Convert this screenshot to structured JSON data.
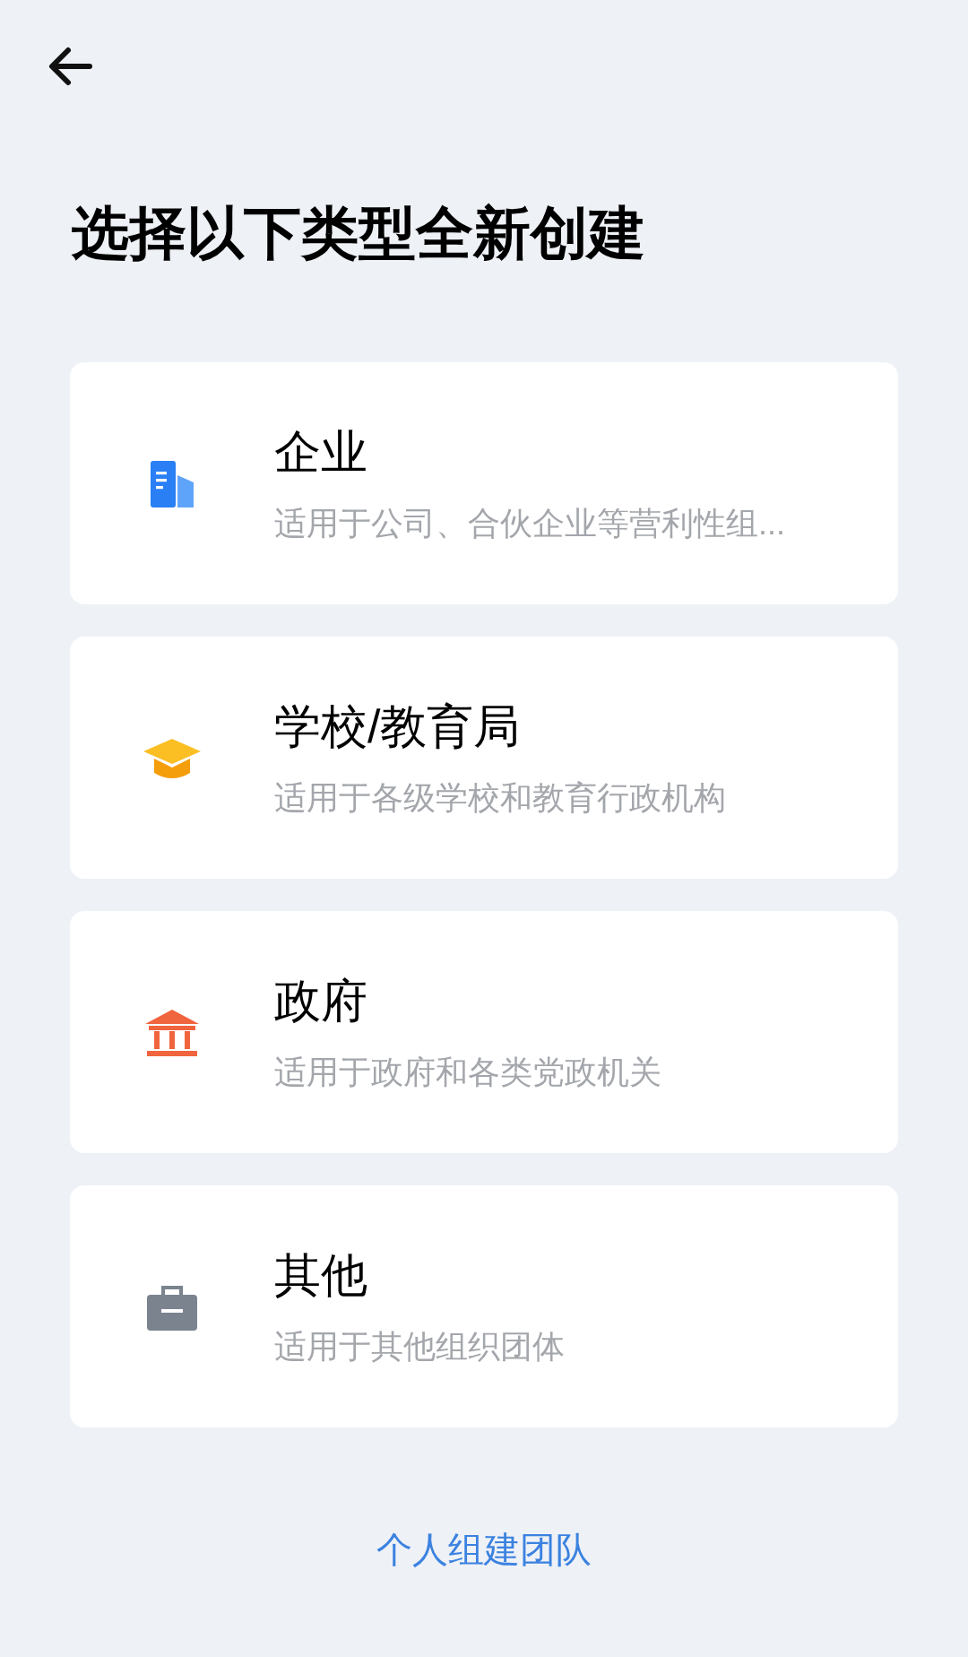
{
  "title": "选择以下类型全新创建",
  "options": [
    {
      "kind": "enterprise",
      "name": "企业",
      "description": "适用于公司、合伙企业等营利性组..."
    },
    {
      "kind": "school",
      "name": "学校/教育局",
      "description": "适用于各级学校和教育行政机构"
    },
    {
      "kind": "government",
      "name": "政府",
      "description": "适用于政府和各类党政机关"
    },
    {
      "kind": "other",
      "name": "其他",
      "description": "适用于其他组织团体"
    }
  ],
  "footer_link": "个人组建团队"
}
